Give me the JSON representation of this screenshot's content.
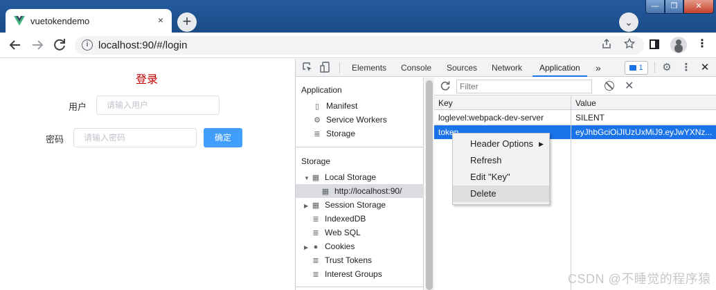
{
  "browser": {
    "tab_title": "vuetokendemo",
    "tab_close": "×",
    "new_tab": "+",
    "tab_search": "⌄",
    "address": "localhost:90/#/login",
    "info_icon": "i",
    "window_min": "—",
    "window_max": "❐",
    "window_close": "✕"
  },
  "login": {
    "title": "登录",
    "username_label": "用户",
    "username_placeholder": "请输入用户",
    "password_label": "密码",
    "password_placeholder": "请输入密码",
    "confirm_label": "确定"
  },
  "devtools": {
    "tabs": [
      {
        "label": "Elements"
      },
      {
        "label": "Console"
      },
      {
        "label": "Sources"
      },
      {
        "label": "Network"
      },
      {
        "label": "Application"
      }
    ],
    "more_tabs": "»",
    "issues_count": "1",
    "sidebar": {
      "application_heading": "Application",
      "application_items": [
        {
          "label": "Manifest",
          "icon": "document-icon"
        },
        {
          "label": "Service Workers",
          "icon": "gear-icon"
        },
        {
          "label": "Storage",
          "icon": "database-icon"
        }
      ],
      "storage_heading": "Storage",
      "storage_items": [
        {
          "label": "Local Storage",
          "icon": "grid-icon"
        },
        {
          "label": "http://localhost:90/",
          "icon": "grid-icon"
        },
        {
          "label": "Session Storage",
          "icon": "grid-icon"
        },
        {
          "label": "IndexedDB",
          "icon": "database-icon"
        },
        {
          "label": "Web SQL",
          "icon": "database-icon"
        },
        {
          "label": "Cookies",
          "icon": "cookie-icon"
        },
        {
          "label": "Trust Tokens",
          "icon": "database-icon"
        },
        {
          "label": "Interest Groups",
          "icon": "database-icon"
        }
      ]
    },
    "filter_placeholder": "Filter",
    "table": {
      "columns": [
        "Key",
        "Value"
      ],
      "rows": [
        {
          "key": "loglevel:webpack-dev-server",
          "value": "SILENT"
        },
        {
          "key": "token",
          "value": "eyJhbGciOiJIUzUxMiJ9.eyJwYXNz..."
        }
      ]
    },
    "context_menu": [
      {
        "label": "Header Options"
      },
      {
        "label": "Refresh"
      },
      {
        "label": "Edit \"Key\""
      },
      {
        "label": "Delete"
      }
    ]
  },
  "watermark": "CSDN @不睡觉的程序猿",
  "colors": {
    "accent": "#1a73e8",
    "login_title": "#c00000",
    "confirm_button": "#409eff"
  }
}
